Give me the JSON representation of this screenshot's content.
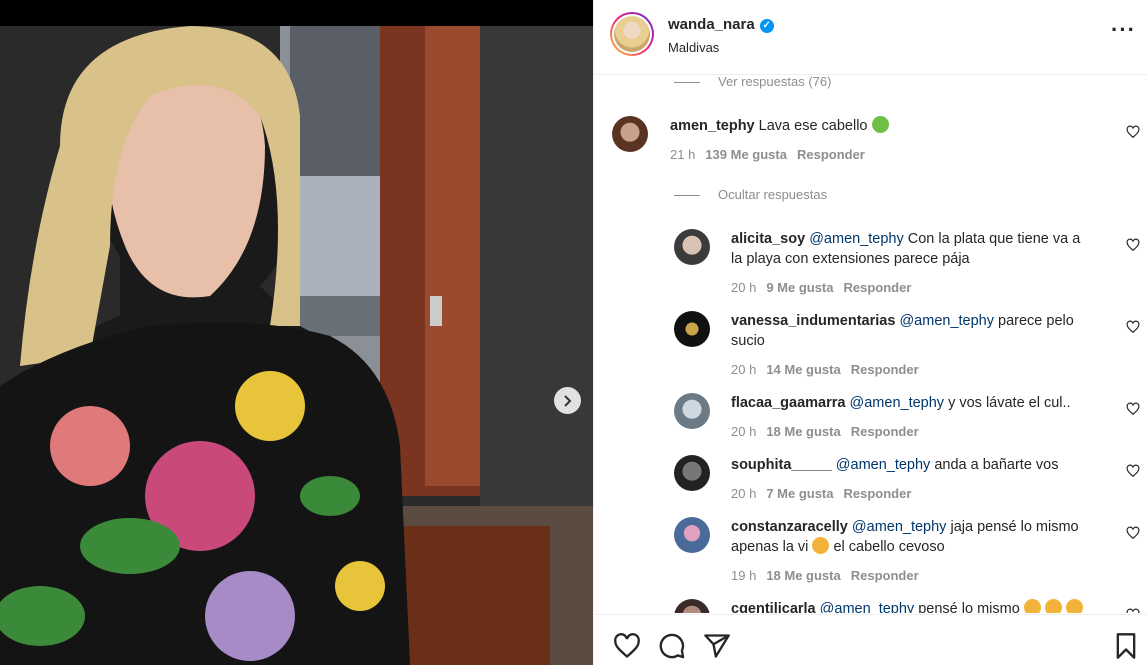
{
  "post": {
    "username": "wanda_nara",
    "location": "Maldivas"
  },
  "comments": {
    "view_replies_top": "Ver respuestas (76)",
    "main": {
      "username": "amen_tephy",
      "text": "Lava ese cabello",
      "time": "21 h",
      "likes": "139 Me gusta",
      "reply": "Responder"
    },
    "hide_replies": "Ocultar respuestas",
    "replies": [
      {
        "username": "alicita_soy",
        "mention": "@amen_tephy",
        "text_line1": "Con la plata que tiene va a",
        "text_line2": "la playa con extensiones parece pája",
        "time": "20 h",
        "likes": "9 Me gusta",
        "reply": "Responder"
      },
      {
        "username": "vanessa_indumentarias",
        "mention": "@amen_tephy",
        "text_line1": "parece pelo",
        "text_line2": "sucio",
        "time": "20 h",
        "likes": "14 Me gusta",
        "reply": "Responder"
      },
      {
        "username": "flacaa_gaamarra",
        "mention": "@amen_tephy",
        "text_line1": "y vos lávate el cul..",
        "time": "20 h",
        "likes": "18 Me gusta",
        "reply": "Responder"
      },
      {
        "username": "souphita_____",
        "mention": "@amen_tephy",
        "text_line1": "anda a bañarte vos",
        "time": "20 h",
        "likes": "7 Me gusta",
        "reply": "Responder"
      },
      {
        "username": "constanzaracelly",
        "mention": "@amen_tephy",
        "text_line1": "jaja pensé lo mismo",
        "text_line2a": "apenas la vi",
        "text_line2b": "el cabello cevoso",
        "time": "19 h",
        "likes": "18 Me gusta",
        "reply": "Responder"
      },
      {
        "username": "cgentilicarla",
        "mention": "@amen_tephy",
        "text_line1": "pensé lo mismo"
      }
    ]
  },
  "colors": {
    "mention": "#00376b",
    "verified": "#0095f6",
    "meta": "#8e8e8e"
  }
}
